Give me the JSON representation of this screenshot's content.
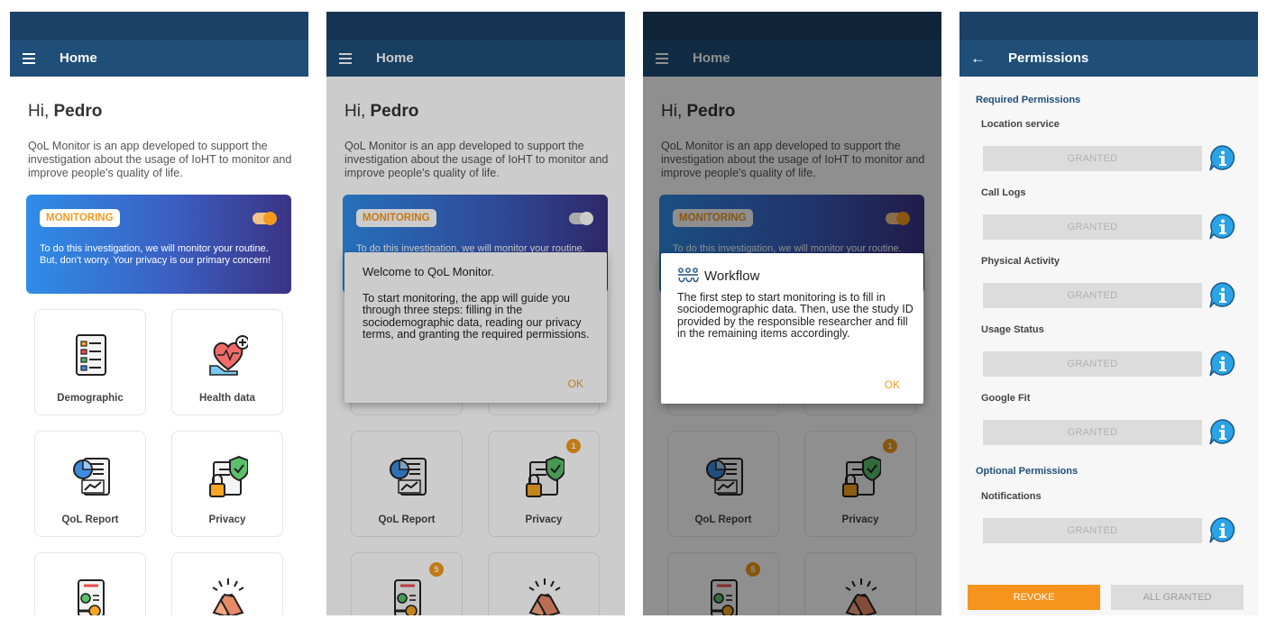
{
  "home": {
    "title": "Home",
    "greeting_prefix": "Hi, ",
    "user_name": "Pedro",
    "intro": "QoL Monitor is an app developed to support the investigation about the usage of IoHT to monitor and improve people's quality of life.",
    "monitoring_label": "MONITORING",
    "monitoring_text": "To do this investigation, we will monitor your routine. But, don't worry. Your privacy is our primary concern!",
    "tiles": {
      "demographic": "Demographic",
      "health": "Health data",
      "qol": "QoL Report",
      "privacy": "Privacy"
    },
    "badges": {
      "privacy": "1",
      "terms": "5"
    }
  },
  "welcome_dialog": {
    "title": "Welcome to QoL Monitor.",
    "body": "To start monitoring, the app will guide you through three steps: filling in the sociodemographic data, reading our privacy terms, and granting the required permissions.",
    "ok": "OK"
  },
  "workflow_dialog": {
    "title": "Workflow",
    "body": "The first step to start monitoring is to fill in sociodemographic data. Then, use the study ID provided by the responsible researcher and fill in the remaining items accordingly.",
    "ok": "OK"
  },
  "permissions": {
    "title": "Permissions",
    "required_header": "Required Permissions",
    "optional_header": "Optional Permissions",
    "required": [
      {
        "label": "Location service",
        "status": "GRANTED"
      },
      {
        "label": "Call Logs",
        "status": "GRANTED"
      },
      {
        "label": "Physical Activity",
        "status": "GRANTED"
      },
      {
        "label": "Usage Status",
        "status": "GRANTED"
      },
      {
        "label": "Google Fit",
        "status": "GRANTED"
      }
    ],
    "optional": [
      {
        "label": "Notifications",
        "status": "GRANTED"
      }
    ],
    "revoke": "REVOKE",
    "all_granted": "ALL GRANTED"
  },
  "colors": {
    "appbar": "#1f4e79",
    "statusbar": "#1c4166",
    "accent": "#f39a1e",
    "info_icon": "#2aa3e8"
  }
}
